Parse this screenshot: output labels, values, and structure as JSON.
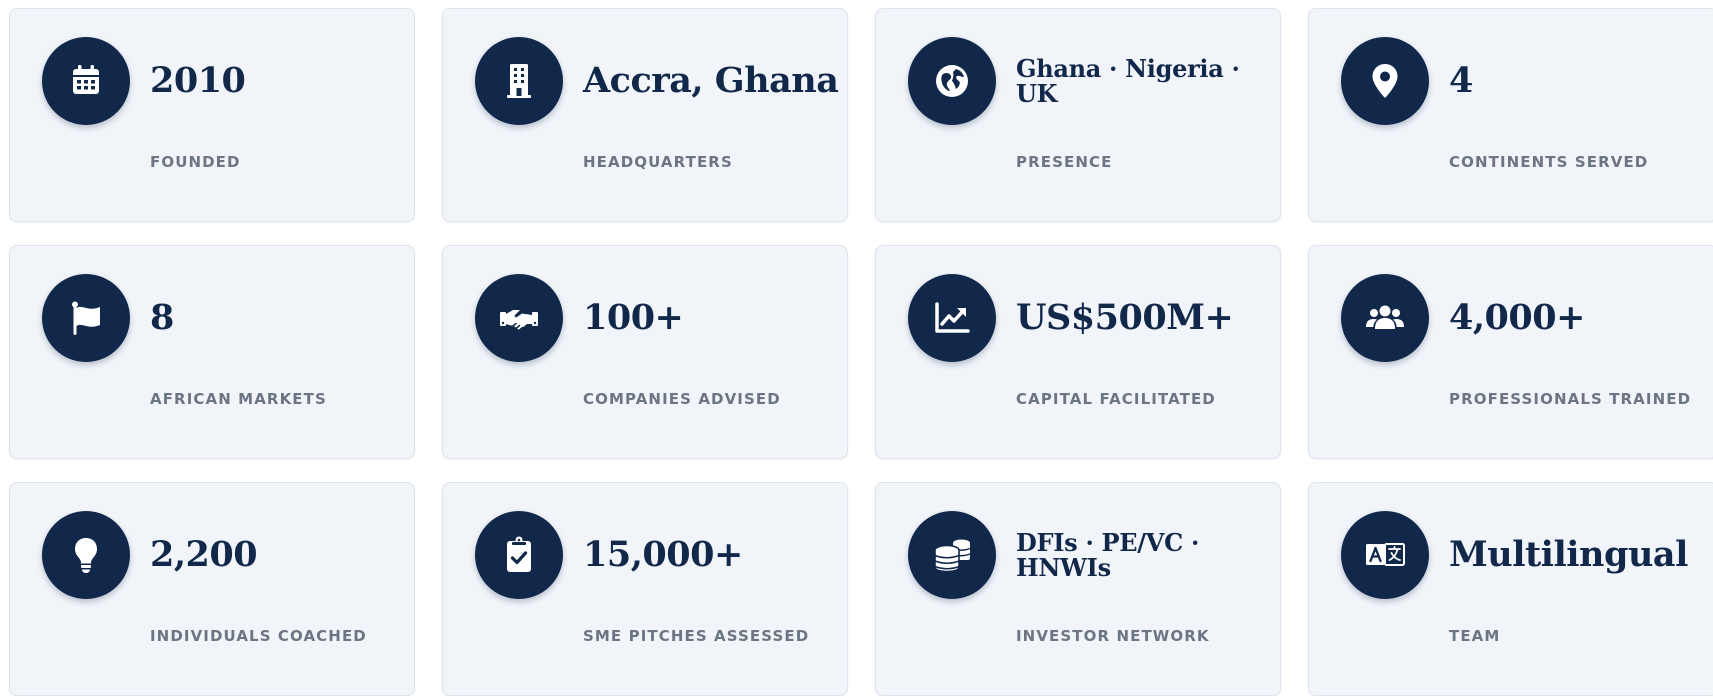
{
  "stats": [
    {
      "value": "2010",
      "label": "FOUNDED",
      "icon": "calendar-icon"
    },
    {
      "value": "Accra, Ghana",
      "label": "HEADQUARTERS",
      "icon": "building-icon"
    },
    {
      "value": "Ghana · Nigeria · UK",
      "label": "PRESENCE",
      "icon": "globe-icon"
    },
    {
      "value": "4",
      "label": "CONTINENTS SERVED",
      "icon": "map-pin-icon"
    },
    {
      "value": "8",
      "label": "AFRICAN MARKETS",
      "icon": "flag-icon"
    },
    {
      "value": "100+",
      "label": "COMPANIES ADVISED",
      "icon": "handshake-icon"
    },
    {
      "value": "US$500M+",
      "label": "CAPITAL FACILITATED",
      "icon": "chart-line-icon"
    },
    {
      "value": "4,000+",
      "label": "PROFESSIONALS TRAINED",
      "icon": "users-icon"
    },
    {
      "value": "2,200",
      "label": "INDIVIDUALS COACHED",
      "icon": "lightbulb-icon"
    },
    {
      "value": "15,000+",
      "label": "SME PITCHES ASSESSED",
      "icon": "clipboard-check-icon"
    },
    {
      "value": "DFIs · PE/VC · HNWIs",
      "label": "INVESTOR NETWORK",
      "icon": "coins-icon"
    },
    {
      "value": "Multilingual",
      "label": "TEAM",
      "icon": "language-icon"
    }
  ],
  "colors": {
    "icon_background": "#11284a",
    "value_text": "#11284a",
    "label_text": "#6b7584",
    "card_background": "#f1f4f9"
  }
}
